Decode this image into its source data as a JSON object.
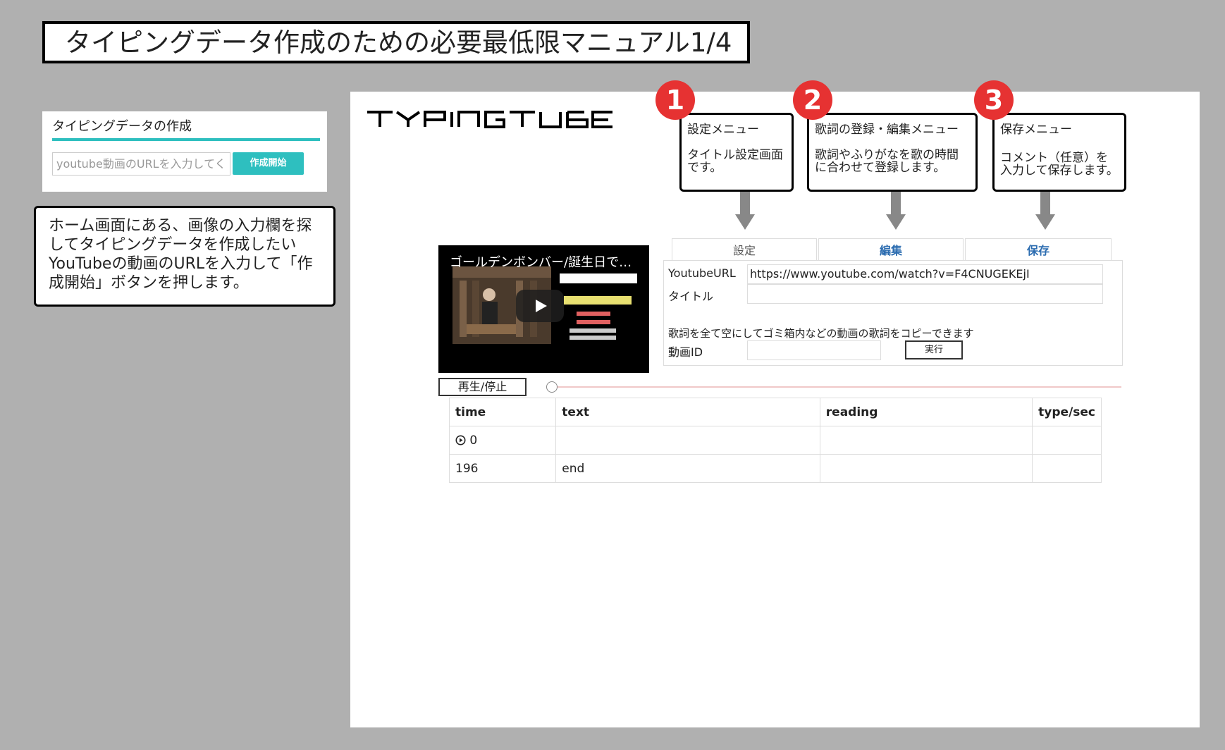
{
  "page_title": "タイピングデータ作成のための必要最低限マニュアル1/4",
  "mini": {
    "heading": "タイピングデータの作成",
    "input_placeholder": "youtube動画のURLを入力してく",
    "button": "作成開始"
  },
  "note": "ホーム画面にある、画像の入力欄を探してタイピングデータを作成したいYouTubeの動画のURLを入力して「作成開始」ボタンを押します。",
  "logo": "TYPINGTUBE",
  "callouts": [
    {
      "num": "1",
      "title": "設定メニュー",
      "body": "タイトル設定画面です。"
    },
    {
      "num": "2",
      "title": "歌詞の登録・編集メニュー",
      "body": "歌詞やふりがなを歌の時間に合わせて登録します。"
    },
    {
      "num": "3",
      "title": "保存メニュー",
      "body": "コメント（任意）を入力して保存します。"
    }
  ],
  "tabs": [
    "設定",
    "編集",
    "保存"
  ],
  "settings": {
    "url_label": "YoutubeURL",
    "url_value": "https://www.youtube.com/watch?v=F4CNUGEKEjI",
    "title_label": "タイトル",
    "title_value": "",
    "copy_note": "歌詞を全て空にしてゴミ箱内などの動画の歌詞をコピーできます",
    "id_label": "動画ID",
    "id_value": "",
    "run_button": "実行"
  },
  "video": {
    "title": "ゴールデンボンバー/誕生日で…"
  },
  "player": {
    "playstop": "再生/停止"
  },
  "table": {
    "headers": [
      "time",
      "text",
      "reading",
      "type/sec"
    ],
    "rows": [
      {
        "time": "0",
        "text": "",
        "reading": "",
        "tps": "",
        "icon": "play-circle-icon"
      },
      {
        "time": "196",
        "text": "end",
        "reading": "",
        "tps": ""
      }
    ]
  },
  "colors": {
    "accent": "#2ebfbf",
    "callout_number": "#e63232",
    "link": "#2b6cb0",
    "background": "#b0b0b0"
  }
}
